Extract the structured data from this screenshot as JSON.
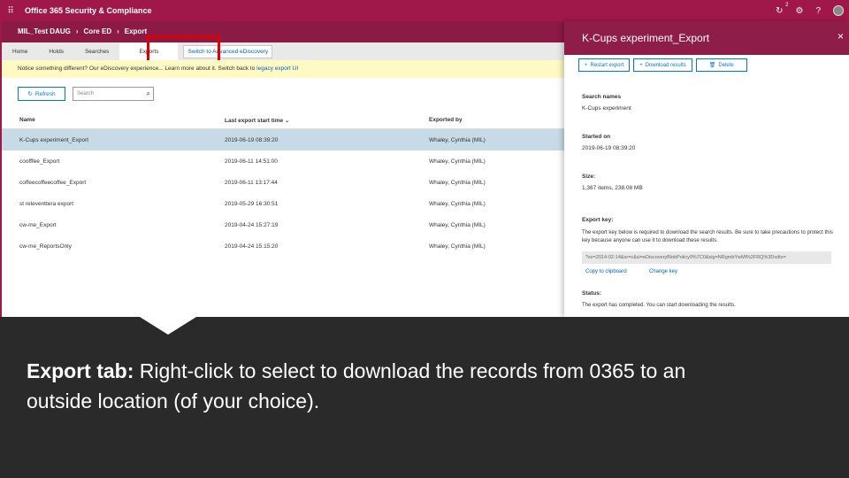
{
  "appbar": {
    "title": "Office 365 Security & Compliance",
    "notif_count": "2",
    "help_icon": "?"
  },
  "breadcrumb": [
    "MIL_Test DAUG",
    "Core ED",
    "Export"
  ],
  "tabs": [
    {
      "label": "Home"
    },
    {
      "label": "Holds"
    },
    {
      "label": "Searches"
    },
    {
      "label": "Exports"
    }
  ],
  "tab_link": "Switch to Advanced eDiscovery",
  "notice": {
    "text": "Notice something different? Our eDiscovery experience... Learn more about it.",
    "switch_text": "Switch back to",
    "link": "legacy export UI"
  },
  "toolbar": {
    "refresh_label": "Refresh",
    "search_placeholder": "Search"
  },
  "table": {
    "headers": [
      "Name",
      "Last export start time",
      "Exported by"
    ],
    "rows": [
      {
        "name": "K-Cups experiment_Export",
        "time": "2019-06-19 08:39:20",
        "by": "Whaley, Cynthia (MIL)",
        "selected": true
      },
      {
        "name": "coofffee_Export",
        "time": "2019-06-11 14:51:00",
        "by": "Whaley, Cynthia (MIL)"
      },
      {
        "name": "coffeecoffeecoffee_Export",
        "time": "2019-06-11 13:17:44",
        "by": "Whaley, Cynthia (MIL)"
      },
      {
        "name": "st releventtera export",
        "time": "2019-05-29 16:30:51",
        "by": "Whaley, Cynthia (MIL)"
      },
      {
        "name": "cw-me_Export",
        "time": "2019-04-24 15:27:19",
        "by": "Whaley, Cynthia (MIL)"
      },
      {
        "name": "cw-me_ReportsOnly",
        "time": "2019-04-24 15:15:20",
        "by": "Whaley, Cynthia (MIL)"
      }
    ]
  },
  "panel": {
    "title": "K-Cups experiment_Export",
    "close": "×",
    "actions": [
      "Restart export",
      "Download results",
      "Delete"
    ],
    "search_names_label": "Search names",
    "search_names_value": "K-Cups experiment",
    "started_label": "Started on",
    "started_value": "2019-06-19 08:39:20",
    "size_label": "Size:",
    "size_value": "1,367 items, 238.08 MB",
    "export_key_label": "Export key:",
    "export_key_desc": "The export key below is required to download the search results. Be sure to take precautions to protect this key because anyone can use it to download these results.",
    "export_key_value": "?sv=2014-02-14&sr=c&si=eDiscoveryBlobPolicy9%7C0&sig=NRgmbYwMl%2FRQ%3Dxdts=",
    "copy_link": "Copy to clipboard",
    "change_link": "Change key",
    "status_label": "Status:",
    "status_value": "The export has completed. You can start downloading the results."
  },
  "caption": {
    "bold": "Export tab:",
    "text": " Right-click to select to download the records from 0365 to an outside location (of your choice)."
  }
}
